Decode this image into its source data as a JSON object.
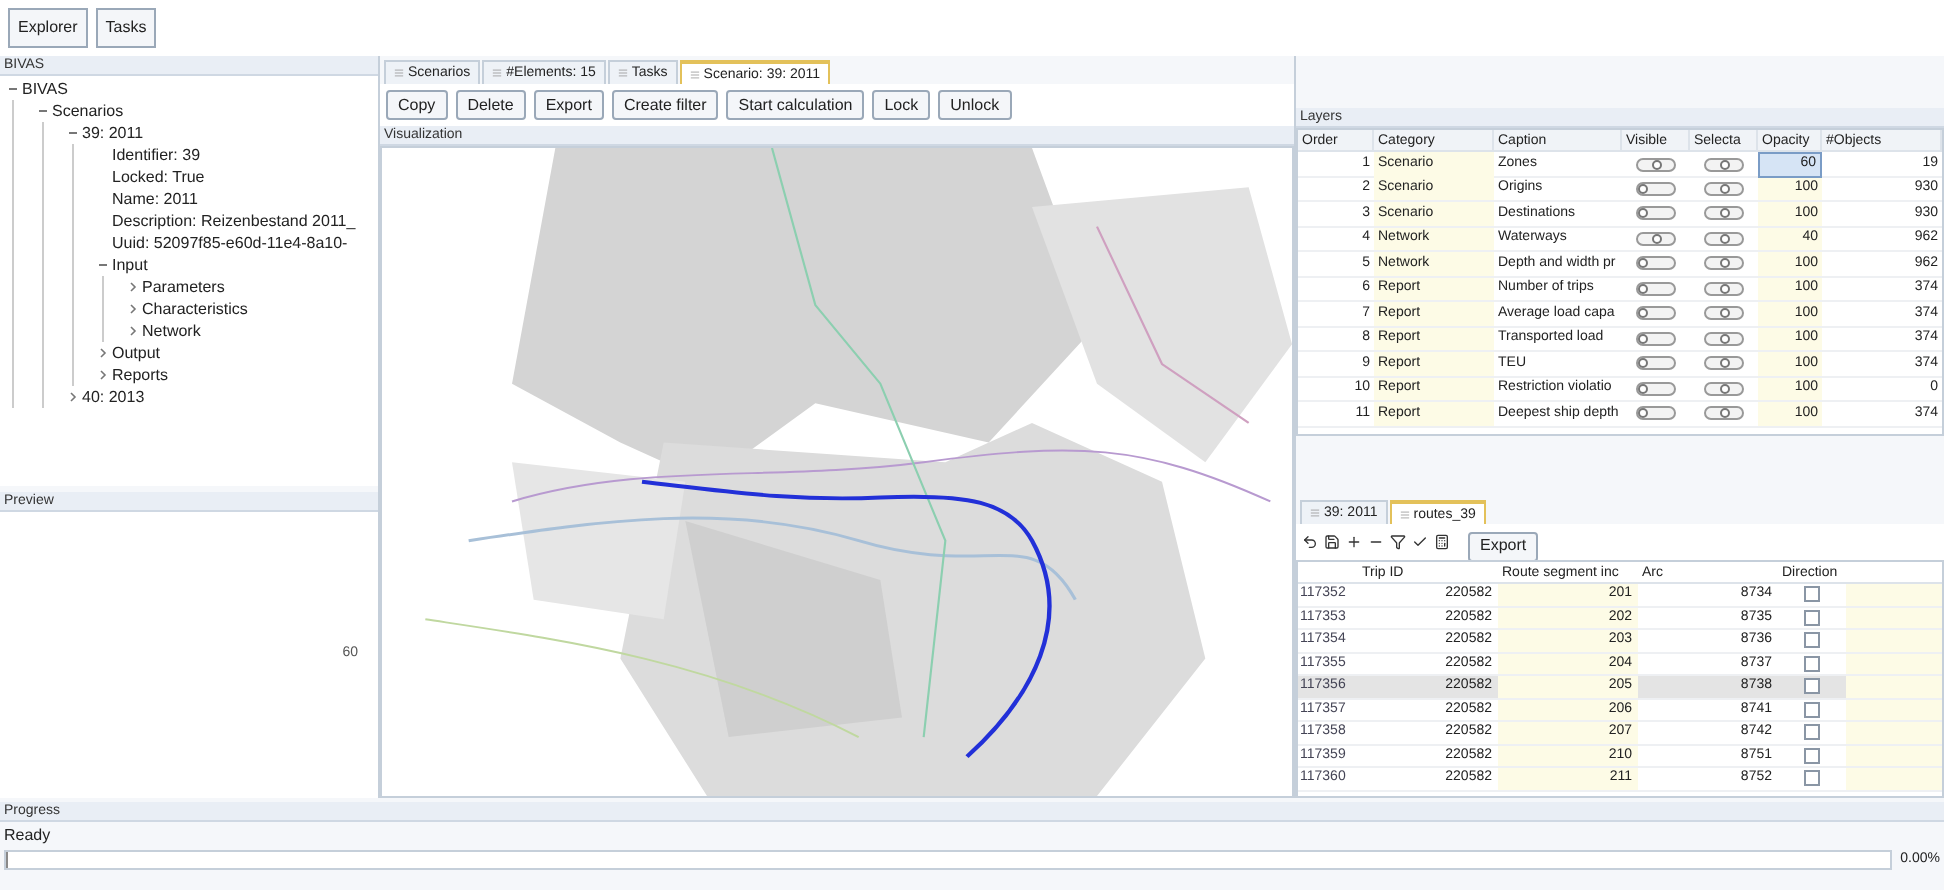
{
  "toolbar": [
    "Explorer",
    "Tasks"
  ],
  "explorer": {
    "title": "BIVAS",
    "tree": [
      {
        "label": "BIVAS",
        "expanded": true,
        "children": [
          {
            "label": "Scenarios",
            "expanded": true,
            "children": [
              {
                "label": "39: 2011",
                "expanded": true,
                "children": [
                  {
                    "label": "Identifier: 39"
                  },
                  {
                    "label": "Locked: True"
                  },
                  {
                    "label": "Name: 2011"
                  },
                  {
                    "label": "Description: Reizenbestand 2011_"
                  },
                  {
                    "label": "Uuid: 52097f85-e60d-11e4-8a10-"
                  },
                  {
                    "label": "Input",
                    "expanded": true,
                    "children": [
                      {
                        "label": "Parameters",
                        "expanded": false
                      },
                      {
                        "label": "Characteristics",
                        "expanded": false
                      },
                      {
                        "label": "Network",
                        "expanded": false
                      }
                    ]
                  },
                  {
                    "label": "Output",
                    "expanded": false
                  },
                  {
                    "label": "Reports",
                    "expanded": false
                  }
                ]
              },
              {
                "label": "40: 2013",
                "expanded": false
              }
            ]
          }
        ]
      }
    ]
  },
  "preview": {
    "title": "Preview",
    "badge": "60"
  },
  "center_tabs": [
    {
      "label": "Scenarios",
      "selected": false
    },
    {
      "label": "#Elements: 15",
      "selected": false
    },
    {
      "label": "Tasks",
      "selected": false
    },
    {
      "label": "Scenario: 39: 2011",
      "selected": true
    }
  ],
  "actions": [
    "Copy",
    "Delete",
    "Export",
    "Create filter",
    "Start calculation",
    "Lock",
    "Unlock"
  ],
  "visualization": {
    "title": "Visualization"
  },
  "layers": {
    "title": "Layers",
    "columns": [
      "Order",
      "Category",
      "Caption",
      "Visible",
      "Selecta",
      "Opacity",
      "#Objects"
    ],
    "rows": [
      {
        "order": "1",
        "category": "Scenario",
        "caption": "Zones",
        "visible": true,
        "selectable": true,
        "opacity": "60",
        "objects": "19",
        "selected": true
      },
      {
        "order": "2",
        "category": "Scenario",
        "caption": "Origins",
        "visible": false,
        "selectable": true,
        "opacity": "100",
        "objects": "930",
        "selected": false
      },
      {
        "order": "3",
        "category": "Scenario",
        "caption": "Destinations",
        "visible": false,
        "selectable": true,
        "opacity": "100",
        "objects": "930",
        "selected": false
      },
      {
        "order": "4",
        "category": "Network",
        "caption": "Waterways",
        "visible": true,
        "selectable": true,
        "opacity": "40",
        "objects": "962",
        "selected": false
      },
      {
        "order": "5",
        "category": "Network",
        "caption": "Depth and width pr",
        "visible": false,
        "selectable": true,
        "opacity": "100",
        "objects": "962",
        "selected": false
      },
      {
        "order": "6",
        "category": "Report",
        "caption": "Number of trips",
        "visible": false,
        "selectable": true,
        "opacity": "100",
        "objects": "374",
        "selected": false
      },
      {
        "order": "7",
        "category": "Report",
        "caption": "Average load capa",
        "visible": false,
        "selectable": true,
        "opacity": "100",
        "objects": "374",
        "selected": false
      },
      {
        "order": "8",
        "category": "Report",
        "caption": "Transported load",
        "visible": false,
        "selectable": true,
        "opacity": "100",
        "objects": "374",
        "selected": false
      },
      {
        "order": "9",
        "category": "Report",
        "caption": "TEU",
        "visible": false,
        "selectable": true,
        "opacity": "100",
        "objects": "374",
        "selected": false
      },
      {
        "order": "10",
        "category": "Report",
        "caption": "Restriction violatio",
        "visible": false,
        "selectable": true,
        "opacity": "100",
        "objects": "0",
        "selected": false
      },
      {
        "order": "11",
        "category": "Report",
        "caption": "Deepest ship depth",
        "visible": false,
        "selectable": true,
        "opacity": "100",
        "objects": "374",
        "selected": false
      }
    ]
  },
  "result_tabs": [
    {
      "label": "39: 2011",
      "selected": false
    },
    {
      "label": "routes_39",
      "selected": true
    }
  ],
  "result_export": "Export",
  "routes": {
    "columns": [
      "Trip ID",
      "Route segment inc",
      "Arc",
      "Direction"
    ],
    "rows": [
      {
        "id": "117352",
        "trip": "220582",
        "segment": "201",
        "arc": "8734",
        "direction": false,
        "selected": false
      },
      {
        "id": "117353",
        "trip": "220582",
        "segment": "202",
        "arc": "8735",
        "direction": false,
        "selected": false
      },
      {
        "id": "117354",
        "trip": "220582",
        "segment": "203",
        "arc": "8736",
        "direction": false,
        "selected": false
      },
      {
        "id": "117355",
        "trip": "220582",
        "segment": "204",
        "arc": "8737",
        "direction": false,
        "selected": false
      },
      {
        "id": "117356",
        "trip": "220582",
        "segment": "205",
        "arc": "8738",
        "direction": false,
        "selected": true
      },
      {
        "id": "117357",
        "trip": "220582",
        "segment": "206",
        "arc": "8741",
        "direction": false,
        "selected": false
      },
      {
        "id": "117358",
        "trip": "220582",
        "segment": "207",
        "arc": "8742",
        "direction": false,
        "selected": false
      },
      {
        "id": "117359",
        "trip": "220582",
        "segment": "210",
        "arc": "8751",
        "direction": false,
        "selected": false
      },
      {
        "id": "117360",
        "trip": "220582",
        "segment": "211",
        "arc": "8752",
        "direction": false,
        "selected": false
      }
    ]
  },
  "progress": {
    "title": "Progress",
    "status": "Ready",
    "level": 0,
    "reading": "0.00%"
  }
}
